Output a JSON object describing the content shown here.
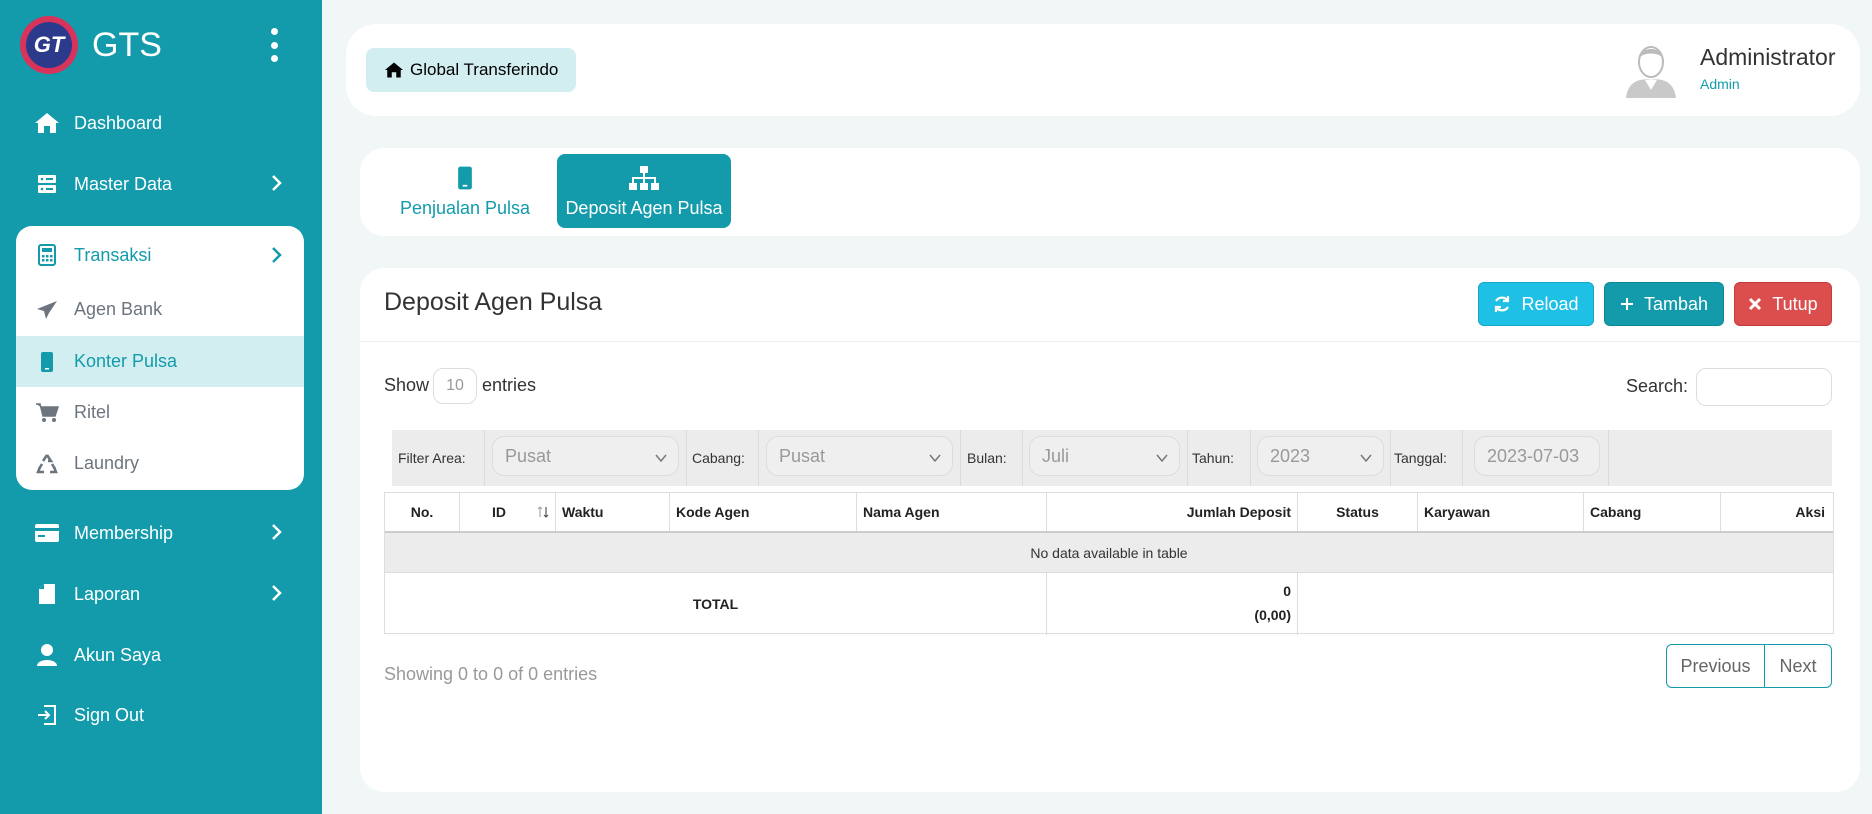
{
  "brand": {
    "logo_text": "GT",
    "name": "GTS"
  },
  "sidebar": {
    "items": [
      {
        "label": "Dashboard",
        "icon": "home-icon"
      },
      {
        "label": "Master Data",
        "icon": "server-icon"
      },
      {
        "label": "Transaksi",
        "icon": "calculator-icon"
      },
      {
        "label": "Membership",
        "icon": "credit-card-icon"
      },
      {
        "label": "Laporan",
        "icon": "file-icon"
      },
      {
        "label": "Akun Saya",
        "icon": "user-icon"
      },
      {
        "label": "Sign Out",
        "icon": "sign-out-icon"
      }
    ],
    "transaksi_sub": [
      {
        "label": "Agen Bank",
        "icon": "paper-plane-icon"
      },
      {
        "label": "Konter Pulsa",
        "icon": "mobile-icon",
        "active": true
      },
      {
        "label": "Ritel",
        "icon": "cart-icon"
      },
      {
        "label": "Laundry",
        "icon": "recycle-icon"
      }
    ]
  },
  "header": {
    "breadcrumb": "Global Transferindo",
    "user_name": "Administrator",
    "user_role": "Admin"
  },
  "tabs": [
    {
      "label": "Penjualan Pulsa",
      "icon": "mobile-icon"
    },
    {
      "label": "Deposit Agen Pulsa",
      "icon": "sitemap-icon",
      "active": true
    }
  ],
  "card": {
    "title": "Deposit Agen Pulsa",
    "buttons": {
      "reload": "Reload",
      "add": "Tambah",
      "close": "Tutup"
    },
    "show": "Show",
    "page_length": "10",
    "entries": "entries",
    "search_label": "Search:",
    "search_value": ""
  },
  "filters": {
    "area_label": "Filter Area:",
    "area_value": "Pusat",
    "branch_label": "Cabang:",
    "branch_value": "Pusat",
    "month_label": "Bulan:",
    "month_value": "Juli",
    "year_label": "Tahun:",
    "year_value": "2023",
    "date_label": "Tanggal:",
    "date_value": "2023-07-03"
  },
  "table": {
    "columns": [
      "No.",
      "ID",
      "Waktu",
      "Kode Agen",
      "Nama Agen",
      "Jumlah Deposit",
      "Status",
      "Karyawan",
      "Cabang",
      "Aksi"
    ],
    "empty_message": "No data available in table",
    "total_label": "TOTAL",
    "total_count": "0",
    "total_amount": "(0,00)"
  },
  "footer": {
    "info": "Showing 0 to 0 of 0 entries",
    "prev": "Previous",
    "next": "Next"
  },
  "colors": {
    "primary": "#139bab",
    "info": "#1ec0e6",
    "danger": "#dc4d4d",
    "light_accent": "#d2eef1"
  }
}
